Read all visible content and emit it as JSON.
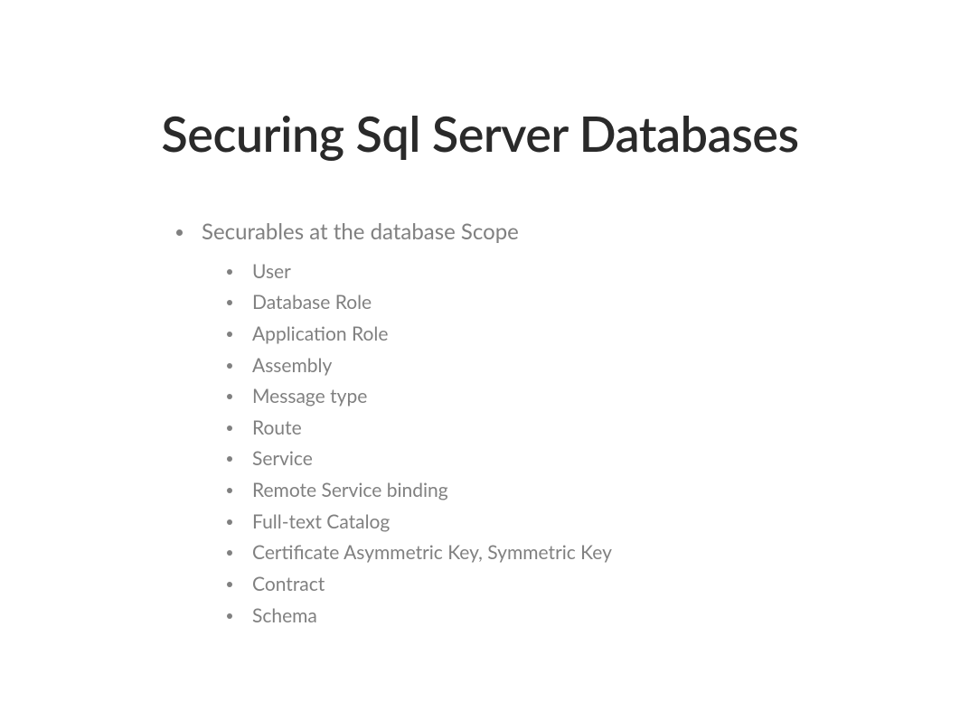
{
  "title": "Securing Sql Server Databases",
  "bullet": {
    "label": "Securables at the database Scope",
    "items": [
      "User",
      "Database Role",
      "Application Role",
      "Assembly",
      "Message type",
      "Route",
      "Service",
      "Remote Service binding",
      "Full-text Catalog",
      "Certificate Asymmetric Key, Symmetric Key",
      "Contract",
      "Schema"
    ]
  }
}
